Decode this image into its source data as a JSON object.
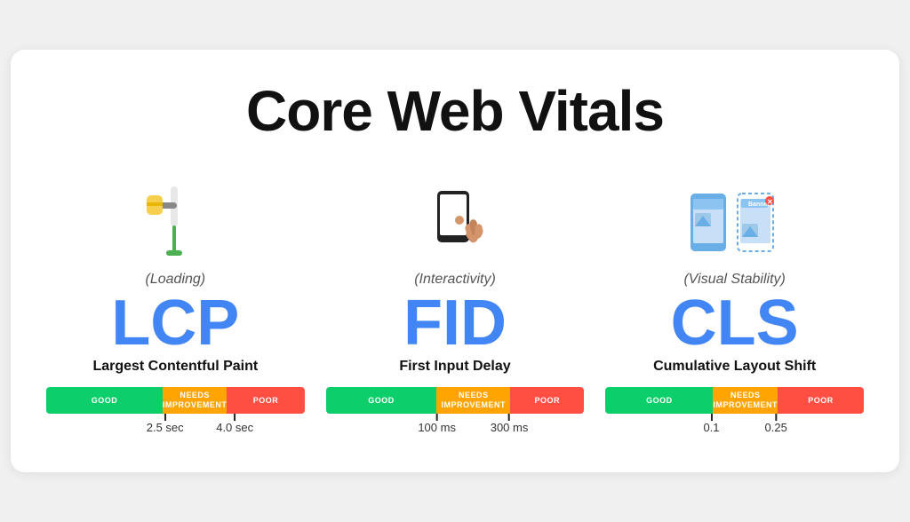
{
  "title": "Core Web Vitals",
  "metrics": [
    {
      "id": "lcp",
      "icon": "🖌️",
      "category": "(Loading)",
      "abbr": "LCP",
      "full": "Largest Contentful Paint",
      "bar": {
        "good_label": "GOOD",
        "needs_label": "NEEDS\nIMPROVEMENT",
        "poor_label": "POOR"
      },
      "tick1_value": "2.5 sec",
      "tick2_value": "4.0 sec",
      "tick1_pct": "46",
      "tick2_pct": "73"
    },
    {
      "id": "fid",
      "icon": "👆",
      "category": "(Interactivity)",
      "abbr": "FID",
      "full": "First Input Delay",
      "bar": {
        "good_label": "GOOD",
        "needs_label": "NEEDS\nIMPROVEMENT",
        "poor_label": "POOR"
      },
      "tick1_value": "100 ms",
      "tick2_value": "300 ms",
      "tick1_pct": "43",
      "tick2_pct": "71"
    },
    {
      "id": "cls",
      "icon": "📱",
      "category": "(Visual Stability)",
      "abbr": "CLS",
      "full": "Cumulative Layout Shift",
      "bar": {
        "good_label": "GOOD",
        "needs_label": "NEEDS\nIMPROVEMENT",
        "poor_label": "POOR"
      },
      "tick1_value": "0.1",
      "tick2_value": "0.25",
      "tick1_pct": "41",
      "tick2_pct": "66"
    }
  ]
}
